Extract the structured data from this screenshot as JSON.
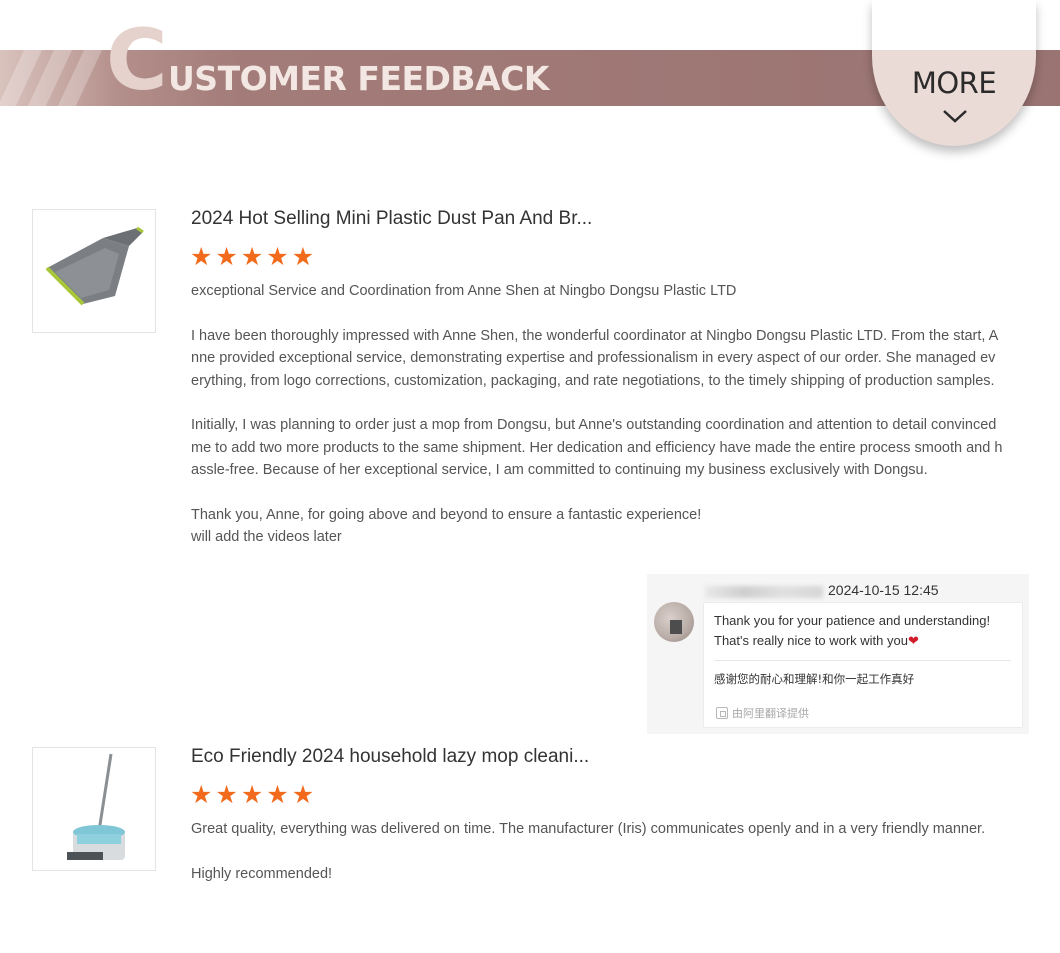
{
  "header": {
    "big_letter": "C",
    "title": "USTOMER FEEDBACK",
    "more_label": "MORE",
    "more_icon": "chevron-down-icon"
  },
  "reviews": [
    {
      "product_title": "2024 Hot Selling Mini Plastic Dust Pan And Br...",
      "product_image": "dustpan-image",
      "rating": 5,
      "paragraphs": [
        "exceptional Service and Coordination from Anne Shen at Ningbo Dongsu Plastic LTD",
        "I have been thoroughly impressed with Anne Shen, the wonderful coordinator at Ningbo Dongsu Plastic LTD. From the start, Anne provided exceptional service, demonstrating expertise and professionalism in every aspect of our order. She managed everything, from logo corrections, customization, packaging, and rate negotiations, to the timely shipping of production samples.",
        "Initially, I was planning to order just a mop from Dongsu, but Anne's outstanding coordination and attention to detail convinced me to add two more products to the same shipment. Her dedication and efficiency have made the entire process smooth and hassle-free. Because of her exceptional service, I am committed to continuing my business exclusively with Dongsu.",
        "Thank you, Anne, for going above and beyond to ensure a fantastic experience!",
        "will add the videos later"
      ]
    },
    {
      "product_title": "Eco Friendly 2024 household lazy mop cleani...",
      "product_image": "spin-mop-image",
      "rating": 5,
      "paragraphs": [
        "Great quality, everything was delivered on time. The manufacturer (Iris) communicates openly and in a very friendly manner.",
        "Highly recommended!"
      ]
    }
  ],
  "reply": {
    "date": "2024-10-15 12:45",
    "message_line1": "Thank you for your patience and understanding!",
    "message_line2": "That's really nice to work with you",
    "heart": "❤",
    "translation": "感谢您的耐心和理解!和你一起工作真好",
    "credit": "由阿里翻译提供"
  },
  "colors": {
    "banner": "#a37c79",
    "star": "#f26b1d",
    "more_circle": "#eadbd6"
  }
}
